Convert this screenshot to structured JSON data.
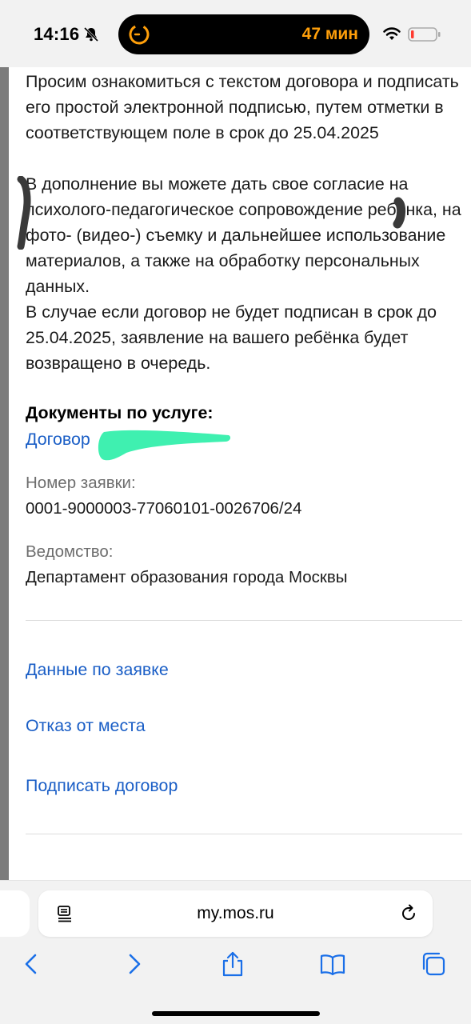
{
  "status_bar": {
    "time": "14:16",
    "island_text": "47 мин",
    "accent_color": "#ff9f0a"
  },
  "content": {
    "paragraph_1": "Просим ознакомиться с текстом договора и подписать его простой электронной подписью, путем отметки в соответствующем поле в срок до 25.04.2025",
    "paragraph_2": "В дополнение вы можете дать свое согласие на психолого-педагогическое сопровождение ребёнка, на фото- (видео-) съемку и дальнейшее использование материалов, а также на обработку персональных данных.",
    "paragraph_3": "В случае если договор не будет подписан в срок до 25.04.2025, заявление на вашего ребёнка будет возвращено в очередь.",
    "documents_heading": "Документы по услуге:",
    "document_link": "Договор",
    "application_number_label": "Номер заявки:",
    "application_number": "0001-9000003-77060101-0026706/24",
    "department_label": "Ведомство:",
    "department": "Департамент образования города Москвы",
    "link_color": "#1a5ec6"
  },
  "actions": {
    "application_data": "Данные по заявке",
    "decline_place": "Отказ от места",
    "sign_contract": "Подписать договор"
  },
  "browser": {
    "url": "my.mos.ru",
    "icons": [
      "reader-icon",
      "reload-icon",
      "back-icon",
      "forward-icon",
      "share-icon",
      "bookmarks-icon",
      "tabs-icon"
    ]
  }
}
